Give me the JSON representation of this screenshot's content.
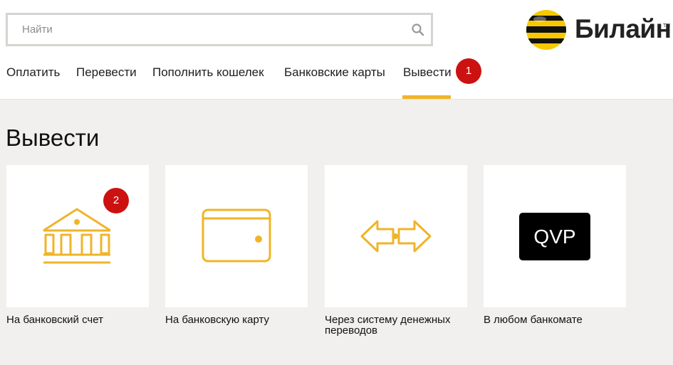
{
  "search": {
    "placeholder": "Найти",
    "value": "",
    "icon": "search-icon"
  },
  "logo": {
    "text": "Билайн",
    "tm": "TM",
    "colors": {
      "yellow": "#f7c800",
      "black": "#111111"
    }
  },
  "nav": {
    "items": [
      {
        "label": "Оплатить",
        "active": false
      },
      {
        "label": "Перевести",
        "active": false
      },
      {
        "label": "Пополнить кошелек",
        "active": false
      },
      {
        "label": "Банковские карты",
        "active": false
      },
      {
        "label": "Вывести",
        "active": true
      }
    ],
    "active_color": "#f0b429"
  },
  "badges": {
    "first": "1",
    "second": "2",
    "color": "#cc1111"
  },
  "page": {
    "title": "Вывести"
  },
  "cards": [
    {
      "label": "На банковский счет",
      "icon": "bank-icon"
    },
    {
      "label": "На банковскую карту",
      "icon": "card-icon"
    },
    {
      "label": "Через систему денежных переводов",
      "icon": "transfer-arrows-icon"
    },
    {
      "label": "В любом банкомате",
      "icon": "qvp-logo-icon",
      "icon_text": "QVP"
    }
  ],
  "icon_color": "#f0b429"
}
